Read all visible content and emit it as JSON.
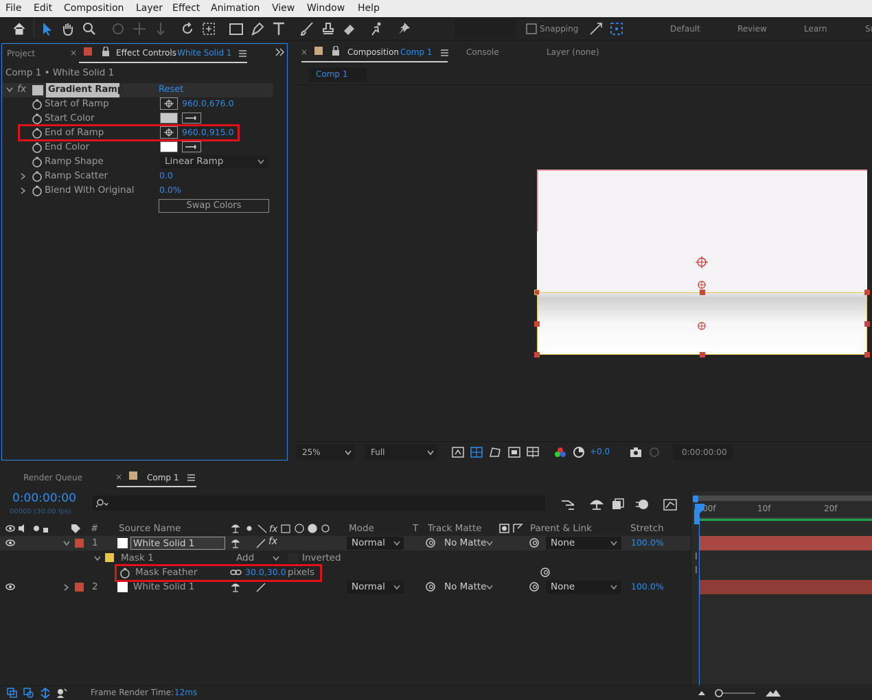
{
  "menu": [
    "File",
    "Edit",
    "Composition",
    "Layer",
    "Effect",
    "Animation",
    "View",
    "Window",
    "Help"
  ],
  "toolbar": {
    "snapping_label": "Snapping",
    "workspaces": [
      "Default",
      "Review",
      "Learn",
      "Sı"
    ]
  },
  "left_panel": {
    "project_tab": "Project",
    "ec_tab_prefix": "Effect Controls",
    "ec_tab_layer": "White Solid 1",
    "breadcrumb": "Comp 1 • White Solid 1",
    "effect_name": "Gradient Ramp",
    "reset_label": "Reset",
    "properties": [
      {
        "name": "Start of Ramp",
        "value": "960.0,676.0"
      },
      {
        "name": "Start Color"
      },
      {
        "name": "End of Ramp",
        "value": "960.0,915.0"
      },
      {
        "name": "End Color"
      },
      {
        "name": "Ramp Shape",
        "value": "Linear Ramp"
      },
      {
        "name": "Ramp Scatter",
        "value": "0.0"
      },
      {
        "name": "Blend With Original",
        "value": "0.0%"
      }
    ],
    "swap_colors_label": "Swap Colors",
    "colors": {
      "start_color": "#c8c8c8",
      "end_color": "#ffffff"
    }
  },
  "comp_panel": {
    "comp_tab_prefix": "Composition",
    "comp_tab_name": "Comp 1",
    "console_tab": "Console",
    "layer_tab": "Layer (none)",
    "viewer_tab": "Comp 1",
    "zoom": "25%",
    "resolution": "Full",
    "exposure": "+0.0",
    "timecode": "0:00:00:00"
  },
  "timeline": {
    "render_queue_tab": "Render Queue",
    "comp_tab": "Comp 1",
    "current_time": "0:00:00:00",
    "frame_info": "00000 (30.00 fps)",
    "search_placeholder": "",
    "headers": {
      "number": "#",
      "source_name": "Source Name",
      "mode": "Mode",
      "t": "T",
      "track_matte": "Track Matte",
      "parent_link": "Parent & Link",
      "stretch": "Stretch"
    },
    "ruler": [
      "00f",
      "10f",
      "20f"
    ],
    "layers": [
      {
        "num": "1",
        "name": "White Solid 1",
        "mode": "Normal",
        "matte": "No Matte",
        "parent": "None",
        "stretch": "100.0%"
      },
      {
        "num": "2",
        "name": "White Solid 1",
        "mode": "Normal",
        "matte": "No Matte",
        "parent": "None",
        "stretch": "100.0%"
      }
    ],
    "mask": {
      "name": "Mask 1",
      "mode": "Add",
      "inverted_label": "Inverted"
    },
    "mask_feather": {
      "name": "Mask Feather",
      "value": "30.0,30.0",
      "unit": "pixels"
    },
    "footer_render_label": "Frame Render Time:",
    "footer_render_value": "12ms",
    "colors": {
      "accent_blue": "#2d8ceb",
      "layer_label_red": "#c8473d",
      "highlight_red": "#e0101c",
      "mask_yellow": "#e4c74a"
    }
  }
}
